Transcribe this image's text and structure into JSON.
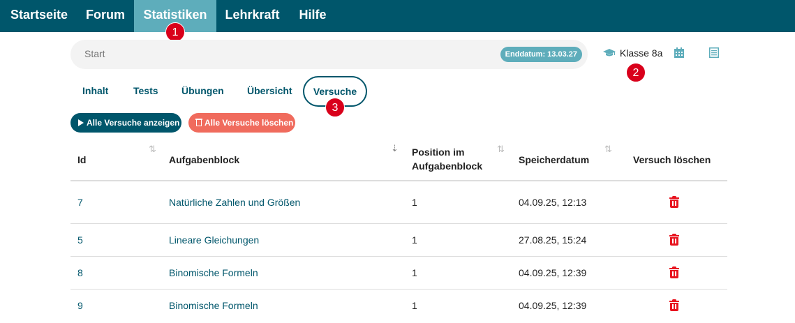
{
  "nav": {
    "items": [
      {
        "label": "Startseite"
      },
      {
        "label": "Forum"
      },
      {
        "label": "Statistiken"
      },
      {
        "label": "Lehrkraft"
      },
      {
        "label": "Hilfe"
      }
    ],
    "active": "Statistiken"
  },
  "markers": [
    "1",
    "2",
    "3"
  ],
  "startbar": {
    "label": "Start",
    "end_date_badge": "Enddatum: 13.03.27"
  },
  "class_selector": {
    "label": "Klasse 8a",
    "icon": "graduation-cap-icon"
  },
  "toolbar_icons": [
    "calendar-icon",
    "list-icon"
  ],
  "tabs": [
    {
      "label": "Inhalt"
    },
    {
      "label": "Tests"
    },
    {
      "label": "Übungen"
    },
    {
      "label": "Übersicht"
    },
    {
      "label": "Versuche",
      "active": true
    }
  ],
  "actions": {
    "show_all": "Alle Versuche anzeigen",
    "delete_all": "Alle Versuche löschen"
  },
  "table": {
    "columns": {
      "id": "Id",
      "block": "Aufgabenblock",
      "position_line1": "Position im",
      "position_line2": "Aufgabenblock",
      "date": "Speicherdatum",
      "delete": "Versuch löschen"
    },
    "rows": [
      {
        "id": "7",
        "block": "Natürliche Zahlen und Größen",
        "position": "1",
        "date": "04.09.25, 12:13"
      },
      {
        "id": "5",
        "block": "Lineare Gleichungen",
        "position": "1",
        "date": "27.08.25, 15:24"
      },
      {
        "id": "8",
        "block": "Binomische Formeln",
        "position": "1",
        "date": "04.09.25, 12:39"
      },
      {
        "id": "9",
        "block": "Binomische Formeln",
        "position": "1",
        "date": "04.09.25, 12:39"
      }
    ]
  },
  "colors": {
    "nav_bg": "#00566b",
    "nav_active": "#5eadbb",
    "delete_button": "#f06b5d",
    "trash": "#e8141f",
    "marker": "#d9001b"
  }
}
